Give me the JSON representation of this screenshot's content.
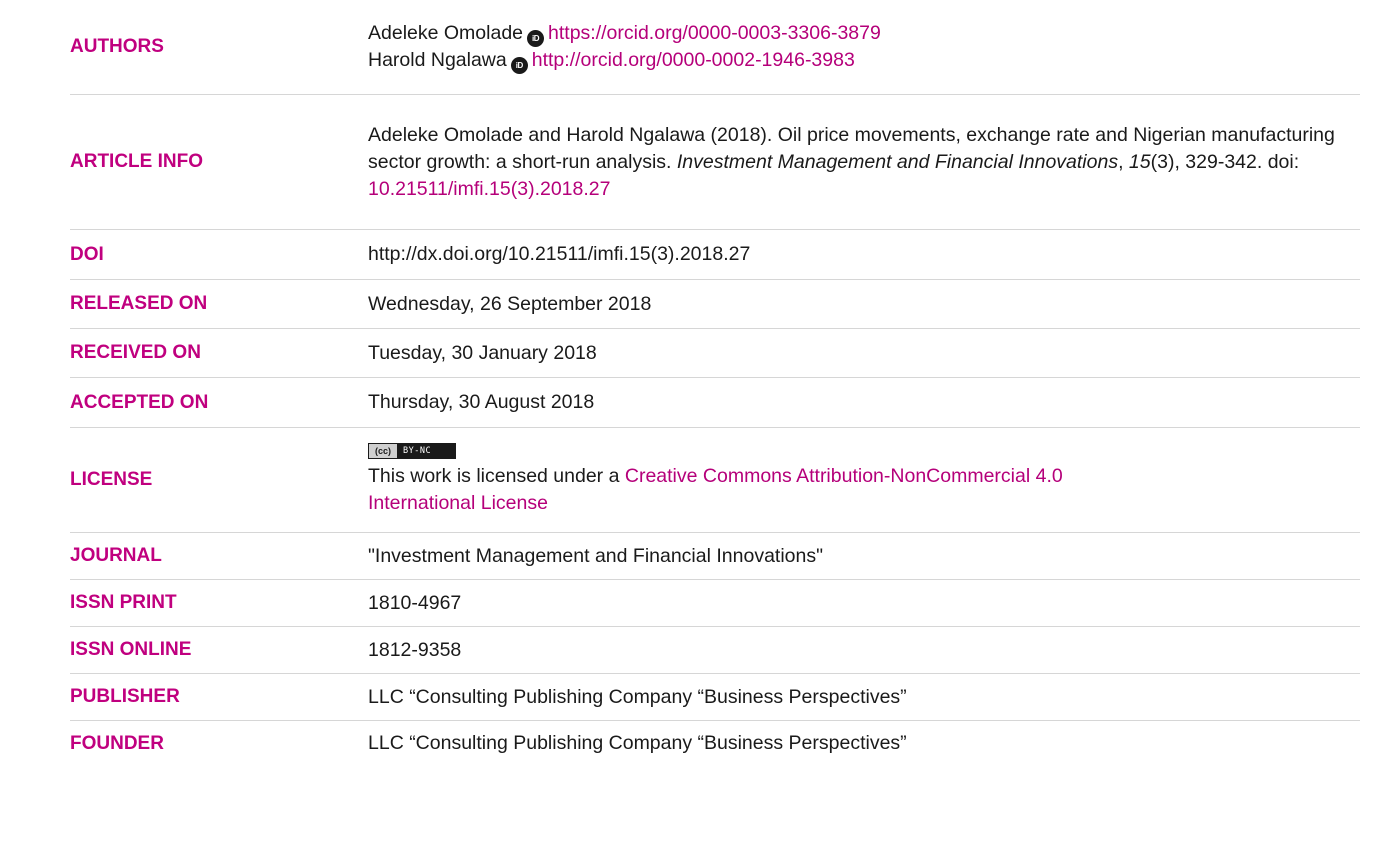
{
  "authors": {
    "label": "AUTHORS",
    "list": [
      {
        "name": "Adeleke Omolade",
        "orcid_icon": "iD",
        "orcid_url": "https://orcid.org/0000-0003-3306-3879"
      },
      {
        "name": "Harold Ngalawa",
        "orcid_icon": "iD",
        "orcid_url": "http://orcid.org/0000-0002-1946-3983"
      }
    ]
  },
  "article_info": {
    "label": "ARTICLE INFO",
    "citation_main": "Adeleke Omolade and Harold Ngalawa (2018). Oil price movements, exchange rate and Nigerian manufacturing sector growth: a short-run analysis. ",
    "journal_italic": "Investment Management and Financial Innovations",
    "sep1": ", ",
    "volume_italic": "15",
    "issue_pages": "(3), 329-342. doi: ",
    "doi_link": "10.21511/imfi.15(3).2018.27"
  },
  "doi": {
    "label": "DOI",
    "value": "http://dx.doi.org/10.21511/imfi.15(3).2018.27"
  },
  "released": {
    "label": "RELEASED ON",
    "value": "Wednesday, 26 September 2018"
  },
  "received": {
    "label": "RECEIVED ON",
    "value": "Tuesday, 30 January 2018"
  },
  "accepted": {
    "label": "ACCEPTED ON",
    "value": "Thursday, 30 August 2018"
  },
  "license": {
    "label": "LICENSE",
    "badge_left": "(cc)",
    "badge_right": "BY-NC",
    "text_prefix": "This work is licensed under a ",
    "link_line1": "Creative Commons Attribution-NonCommercial 4.0",
    "link_line2": "International License"
  },
  "journal": {
    "label": "JOURNAL",
    "value": "\"Investment Management and Financial Innovations\""
  },
  "issn_print": {
    "label": "ISSN PRINT",
    "value": "1810-4967"
  },
  "issn_online": {
    "label": "ISSN ONLINE",
    "value": "1812-9358"
  },
  "publisher": {
    "label": "PUBLISHER",
    "value": "LLC “Consulting Publishing Company “Business Perspectives”"
  },
  "founder": {
    "label": "FOUNDER",
    "value": "LLC “Consulting Publishing Company “Business Perspectives”"
  },
  "colors": {
    "accent": "#c0007f",
    "link": "#b5007a",
    "divider": "#d6d6d6",
    "text": "#1a1a1a"
  }
}
